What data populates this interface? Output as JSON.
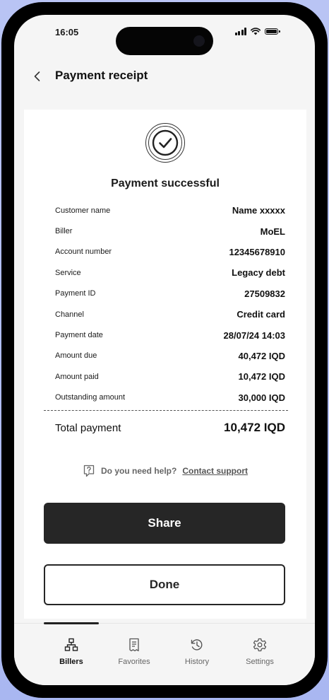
{
  "status_bar": {
    "time": "16:05"
  },
  "header": {
    "title": "Payment receipt"
  },
  "receipt": {
    "status_title": "Payment successful",
    "rows": [
      {
        "label": "Customer name",
        "value": "Name xxxxx"
      },
      {
        "label": "Biller",
        "value": "MoEL"
      },
      {
        "label": "Account number",
        "value": "12345678910"
      },
      {
        "label": "Service",
        "value": "Legacy debt"
      },
      {
        "label": "Payment ID",
        "value": "27509832"
      },
      {
        "label": "Channel",
        "value": "Credit card"
      },
      {
        "label": "Payment date",
        "value": "28/07/24 14:03"
      },
      {
        "label": "Amount due",
        "value": "40,472 IQD"
      },
      {
        "label": "Amount paid",
        "value": "10,472 IQD"
      },
      {
        "label": "Outstanding amount",
        "value": "30,000 IQD"
      }
    ],
    "total_label": "Total payment",
    "total_value": "10,472 IQD"
  },
  "help": {
    "question": "Do you need help?",
    "link": "Contact support"
  },
  "actions": {
    "share_label": "Share",
    "done_label": "Done"
  },
  "tabbar": {
    "items": [
      {
        "label": "Billers",
        "icon": "billers-icon"
      },
      {
        "label": "Favorites",
        "icon": "favorites-icon"
      },
      {
        "label": "History",
        "icon": "history-icon"
      },
      {
        "label": "Settings",
        "icon": "settings-icon"
      }
    ],
    "active": "Billers"
  },
  "colors": {
    "background": "#b0bdf3",
    "primary": "#262626",
    "surface": "#ffffff"
  }
}
